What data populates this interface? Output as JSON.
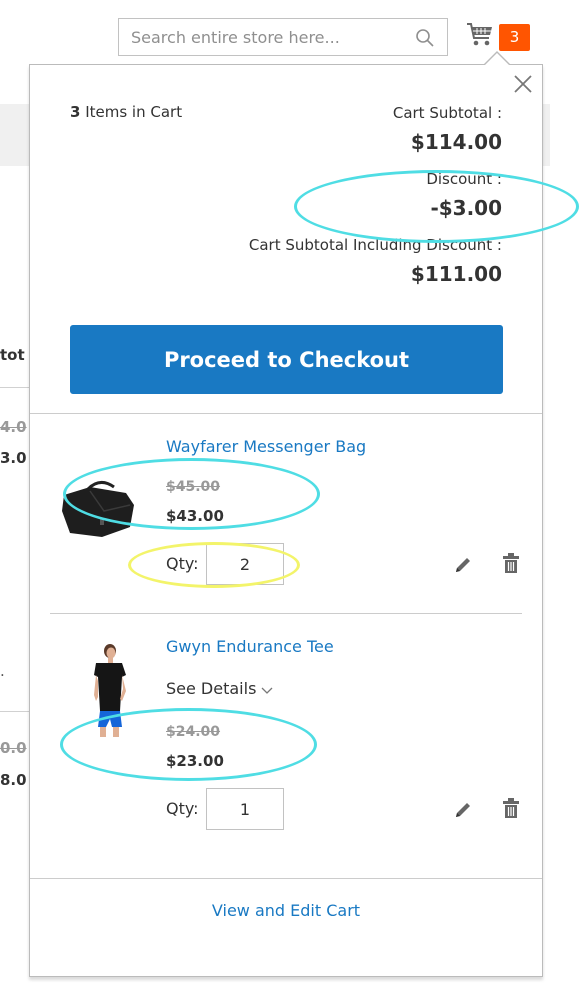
{
  "header": {
    "search_placeholder": "Search entire store here...",
    "cart_count": "3"
  },
  "background": {
    "column_fragment": "tot",
    "row1_old": "4.0",
    "row1_new": "3.0",
    "row2_old": "0.0",
    "row2_new": "8.0",
    "dot": "."
  },
  "minicart": {
    "items_count_number": "3",
    "items_count_label": " Items in Cart",
    "subtotal_label": "Cart Subtotal :",
    "subtotal_value": "$114.00",
    "discount_label": "Discount :",
    "discount_value": "-$3.00",
    "subtotal_incl_label": "Cart Subtotal Including Discount :",
    "subtotal_incl_value": "$111.00",
    "checkout_label": "Proceed to Checkout",
    "view_cart_label": "View and Edit Cart",
    "qty_label": "Qty:",
    "items": [
      {
        "name": "Wayfarer Messenger Bag",
        "old_price": "$45.00",
        "price": "$43.00",
        "qty": "2",
        "image": "black-messenger-bag"
      },
      {
        "name": "Gwyn Endurance Tee",
        "details_label": "See Details",
        "old_price": "$24.00",
        "price": "$23.00",
        "qty": "1",
        "image": "woman-black-tee-blue-shorts"
      }
    ]
  },
  "colors": {
    "accent": "#1979c3",
    "badge": "#ff5501",
    "annotation_cyan": "#4fdde4",
    "annotation_yellow": "#f3f46a"
  }
}
